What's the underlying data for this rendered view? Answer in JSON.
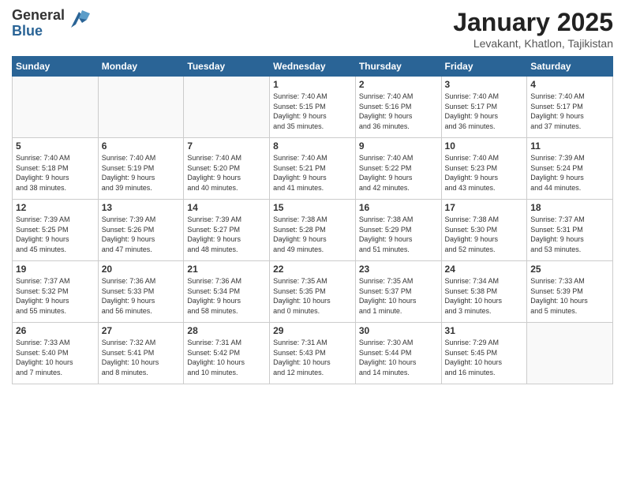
{
  "header": {
    "logo_general": "General",
    "logo_blue": "Blue",
    "month_title": "January 2025",
    "location": "Levakant, Khatlon, Tajikistan"
  },
  "weekdays": [
    "Sunday",
    "Monday",
    "Tuesday",
    "Wednesday",
    "Thursday",
    "Friday",
    "Saturday"
  ],
  "weeks": [
    [
      {
        "day": "",
        "info": ""
      },
      {
        "day": "",
        "info": ""
      },
      {
        "day": "",
        "info": ""
      },
      {
        "day": "1",
        "info": "Sunrise: 7:40 AM\nSunset: 5:15 PM\nDaylight: 9 hours\nand 35 minutes."
      },
      {
        "day": "2",
        "info": "Sunrise: 7:40 AM\nSunset: 5:16 PM\nDaylight: 9 hours\nand 36 minutes."
      },
      {
        "day": "3",
        "info": "Sunrise: 7:40 AM\nSunset: 5:17 PM\nDaylight: 9 hours\nand 36 minutes."
      },
      {
        "day": "4",
        "info": "Sunrise: 7:40 AM\nSunset: 5:17 PM\nDaylight: 9 hours\nand 37 minutes."
      }
    ],
    [
      {
        "day": "5",
        "info": "Sunrise: 7:40 AM\nSunset: 5:18 PM\nDaylight: 9 hours\nand 38 minutes."
      },
      {
        "day": "6",
        "info": "Sunrise: 7:40 AM\nSunset: 5:19 PM\nDaylight: 9 hours\nand 39 minutes."
      },
      {
        "day": "7",
        "info": "Sunrise: 7:40 AM\nSunset: 5:20 PM\nDaylight: 9 hours\nand 40 minutes."
      },
      {
        "day": "8",
        "info": "Sunrise: 7:40 AM\nSunset: 5:21 PM\nDaylight: 9 hours\nand 41 minutes."
      },
      {
        "day": "9",
        "info": "Sunrise: 7:40 AM\nSunset: 5:22 PM\nDaylight: 9 hours\nand 42 minutes."
      },
      {
        "day": "10",
        "info": "Sunrise: 7:40 AM\nSunset: 5:23 PM\nDaylight: 9 hours\nand 43 minutes."
      },
      {
        "day": "11",
        "info": "Sunrise: 7:39 AM\nSunset: 5:24 PM\nDaylight: 9 hours\nand 44 minutes."
      }
    ],
    [
      {
        "day": "12",
        "info": "Sunrise: 7:39 AM\nSunset: 5:25 PM\nDaylight: 9 hours\nand 45 minutes."
      },
      {
        "day": "13",
        "info": "Sunrise: 7:39 AM\nSunset: 5:26 PM\nDaylight: 9 hours\nand 47 minutes."
      },
      {
        "day": "14",
        "info": "Sunrise: 7:39 AM\nSunset: 5:27 PM\nDaylight: 9 hours\nand 48 minutes."
      },
      {
        "day": "15",
        "info": "Sunrise: 7:38 AM\nSunset: 5:28 PM\nDaylight: 9 hours\nand 49 minutes."
      },
      {
        "day": "16",
        "info": "Sunrise: 7:38 AM\nSunset: 5:29 PM\nDaylight: 9 hours\nand 51 minutes."
      },
      {
        "day": "17",
        "info": "Sunrise: 7:38 AM\nSunset: 5:30 PM\nDaylight: 9 hours\nand 52 minutes."
      },
      {
        "day": "18",
        "info": "Sunrise: 7:37 AM\nSunset: 5:31 PM\nDaylight: 9 hours\nand 53 minutes."
      }
    ],
    [
      {
        "day": "19",
        "info": "Sunrise: 7:37 AM\nSunset: 5:32 PM\nDaylight: 9 hours\nand 55 minutes."
      },
      {
        "day": "20",
        "info": "Sunrise: 7:36 AM\nSunset: 5:33 PM\nDaylight: 9 hours\nand 56 minutes."
      },
      {
        "day": "21",
        "info": "Sunrise: 7:36 AM\nSunset: 5:34 PM\nDaylight: 9 hours\nand 58 minutes."
      },
      {
        "day": "22",
        "info": "Sunrise: 7:35 AM\nSunset: 5:35 PM\nDaylight: 10 hours\nand 0 minutes."
      },
      {
        "day": "23",
        "info": "Sunrise: 7:35 AM\nSunset: 5:37 PM\nDaylight: 10 hours\nand 1 minute."
      },
      {
        "day": "24",
        "info": "Sunrise: 7:34 AM\nSunset: 5:38 PM\nDaylight: 10 hours\nand 3 minutes."
      },
      {
        "day": "25",
        "info": "Sunrise: 7:33 AM\nSunset: 5:39 PM\nDaylight: 10 hours\nand 5 minutes."
      }
    ],
    [
      {
        "day": "26",
        "info": "Sunrise: 7:33 AM\nSunset: 5:40 PM\nDaylight: 10 hours\nand 7 minutes."
      },
      {
        "day": "27",
        "info": "Sunrise: 7:32 AM\nSunset: 5:41 PM\nDaylight: 10 hours\nand 8 minutes."
      },
      {
        "day": "28",
        "info": "Sunrise: 7:31 AM\nSunset: 5:42 PM\nDaylight: 10 hours\nand 10 minutes."
      },
      {
        "day": "29",
        "info": "Sunrise: 7:31 AM\nSunset: 5:43 PM\nDaylight: 10 hours\nand 12 minutes."
      },
      {
        "day": "30",
        "info": "Sunrise: 7:30 AM\nSunset: 5:44 PM\nDaylight: 10 hours\nand 14 minutes."
      },
      {
        "day": "31",
        "info": "Sunrise: 7:29 AM\nSunset: 5:45 PM\nDaylight: 10 hours\nand 16 minutes."
      },
      {
        "day": "",
        "info": ""
      }
    ]
  ]
}
